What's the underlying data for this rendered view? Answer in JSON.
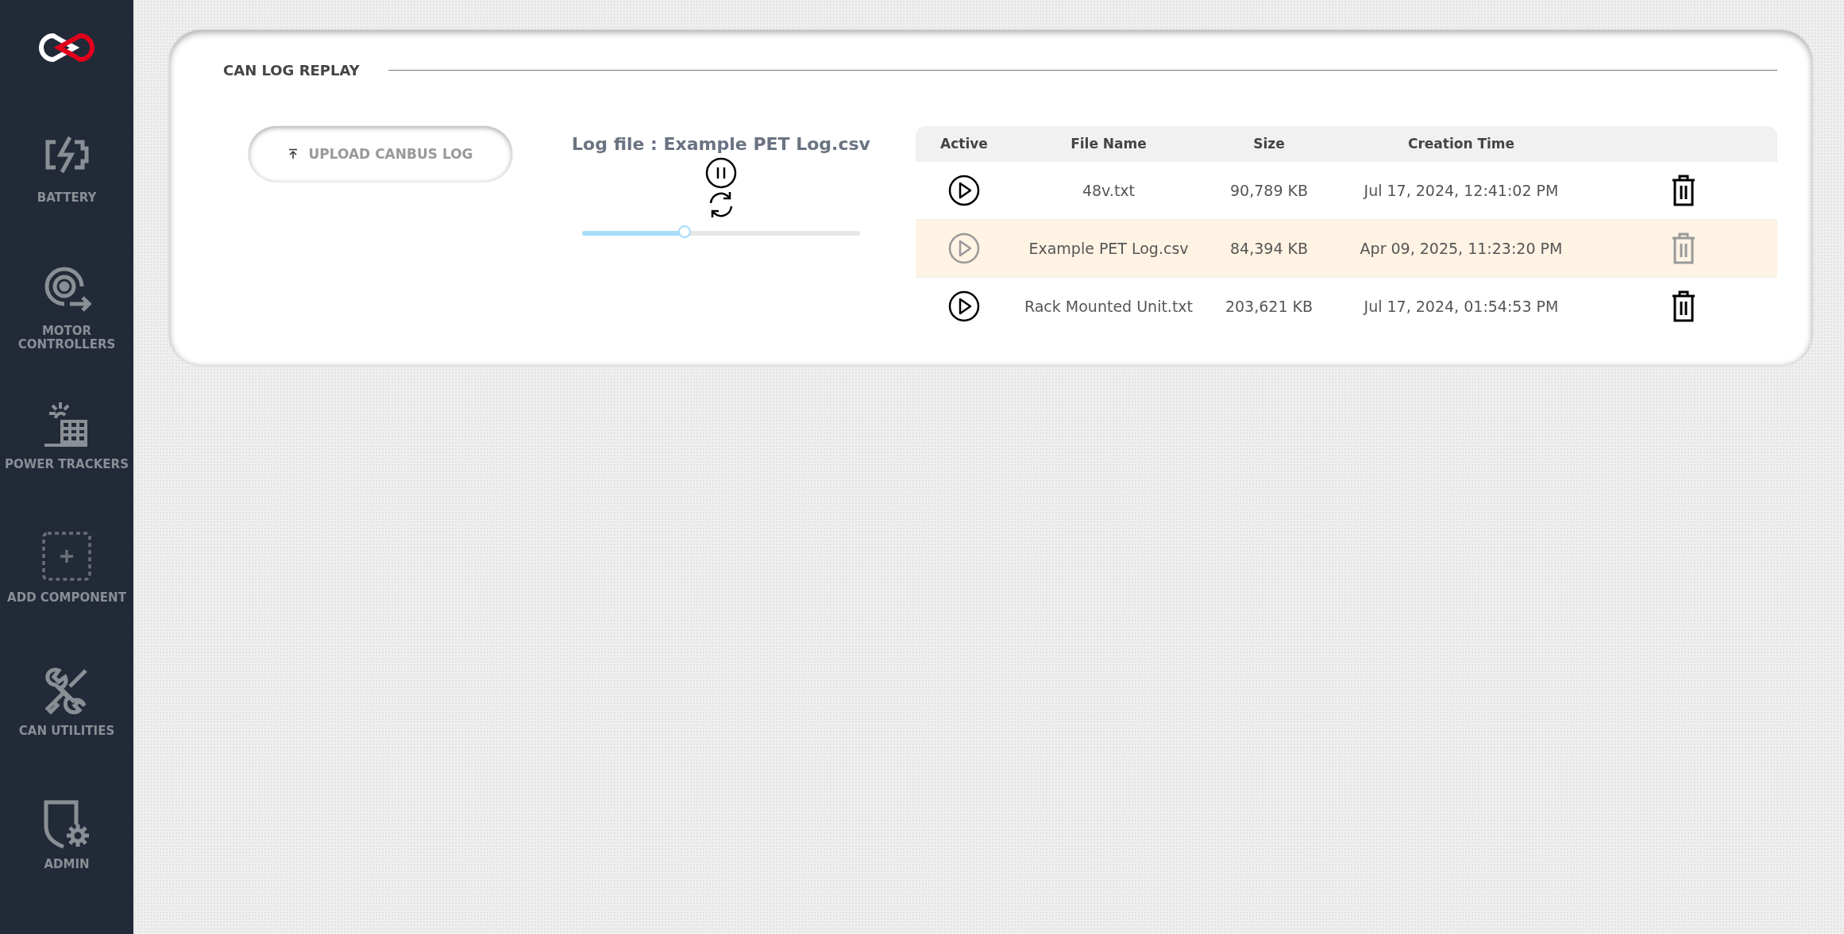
{
  "sidebar": {
    "items": [
      {
        "kind": "battery",
        "label": "BATTERY"
      },
      {
        "kind": "motor",
        "label": "MOTOR CONTROLLERS"
      },
      {
        "kind": "solar",
        "label": "POWER TRACKERS"
      },
      {
        "kind": "add",
        "label": "ADD COMPONENT"
      },
      {
        "kind": "tools",
        "label": "CAN UTILITIES"
      },
      {
        "kind": "admin",
        "label": "ADMIN"
      }
    ]
  },
  "panel": {
    "title": "CAN LOG REPLAY",
    "upload_button": "UPLOAD CANBUS LOG",
    "log_file": "Log file : Example PET Log.csv",
    "playback": {
      "level": 0.37
    },
    "table": {
      "columns": [
        "Active",
        "File Name",
        "Size",
        "Creation Time"
      ],
      "rows": [
        {
          "name": "48v.txt",
          "size": "90,789 KB",
          "created": "Jul 17, 2024, 12:41:02 PM",
          "selected": false
        },
        {
          "name": "Example PET Log.csv",
          "size": "84,394 KB",
          "created": "Apr 09, 2025, 11:23:20 PM",
          "selected": true
        },
        {
          "name": "Rack Mounted Unit.txt",
          "size": "203,621 KB",
          "created": "Jul 17, 2024, 01:54:53 PM",
          "selected": false
        }
      ]
    }
  }
}
